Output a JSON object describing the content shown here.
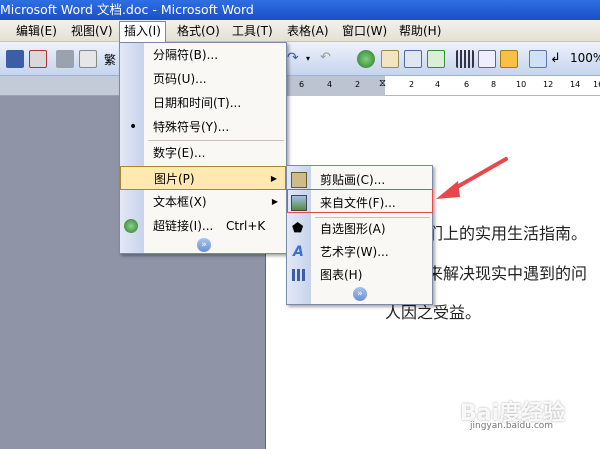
{
  "window": {
    "title": "Microsoft Word 文档.doc - Microsoft Word"
  },
  "menubar": {
    "items": [
      {
        "label": "编辑(E)"
      },
      {
        "label": "视图(V)"
      },
      {
        "label": "插入(I)"
      },
      {
        "label": "格式(O)"
      },
      {
        "label": "工具(T)"
      },
      {
        "label": "表格(A)"
      },
      {
        "label": "窗口(W)"
      },
      {
        "label": "帮助(H)"
      }
    ]
  },
  "toolbar": {
    "zoom": "100%",
    "fan": "繁"
  },
  "ruler": {
    "ticks": [
      "6",
      "4",
      "2",
      "2",
      "4",
      "6",
      "8",
      "10",
      "12",
      "14",
      "16"
    ]
  },
  "document": {
    "lines": [
      "们上的实用生活指南。",
      "来解决现实中遇到的问",
      "人因之受益。"
    ]
  },
  "insert_menu": {
    "items": [
      {
        "label": "分隔符(B)..."
      },
      {
        "label": "页码(U)..."
      },
      {
        "label": "日期和时间(T)..."
      },
      {
        "label": "特殊符号(Y)..."
      },
      {
        "label": "数字(E)..."
      },
      {
        "label": "图片(P)"
      },
      {
        "label": "文本框(X)"
      },
      {
        "label": "超链接(I)...",
        "shortcut": "Ctrl+K"
      }
    ]
  },
  "picture_submenu": {
    "items": [
      {
        "label": "剪贴画(C)..."
      },
      {
        "label": "来自文件(F)..."
      },
      {
        "label": "自选图形(A)"
      },
      {
        "label": "艺术字(W)..."
      },
      {
        "label": "图表(H)"
      }
    ]
  },
  "watermark": {
    "text": "Bai度经验",
    "sub": "jingyan.baidu.com"
  },
  "colors": {
    "highlight": "#ffe9b0",
    "annotation": "#e5484d",
    "titlebar": "#1a4fc7"
  }
}
